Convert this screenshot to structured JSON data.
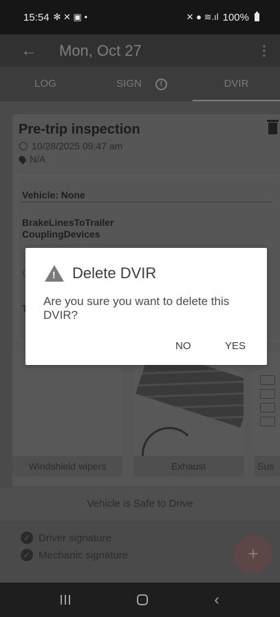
{
  "status_bar": {
    "time": "15:54",
    "left_icons": "✻ ✕ ▣ •",
    "right_icons": "✕ ● ≋.ıl",
    "battery": "100%"
  },
  "app_bar": {
    "back_icon": "arrow-left-icon",
    "title": "Mon, Oct 27",
    "menu_icon": "more-vert-icon"
  },
  "tabs": [
    {
      "label": "LOG"
    },
    {
      "label": "SIGN"
    },
    {
      "label": "DVIR",
      "selected": true
    }
  ],
  "inspection": {
    "title": "Pre-trip inspection",
    "datetime": "10/28/2025 09:47 am",
    "location": "N/A",
    "vehicle": "Vehicle: None",
    "defects": [
      "BrakeLinesToTrailer",
      "CouplingDevices"
    ],
    "peek_a": "C",
    "peek_b": "T"
  },
  "photos": [
    {
      "caption": "Windshield wipers"
    },
    {
      "caption": "Exhaust"
    },
    {
      "caption": "Sus"
    }
  ],
  "safe_status": "Vehicle is Safe to Drive",
  "signatures": [
    {
      "label": "Driver signature"
    },
    {
      "label": "Mechanic signature"
    }
  ],
  "fab_label": "+",
  "dialog": {
    "title": "Delete DVIR",
    "message": "Are you sure you want to delete this DVIR?",
    "no_label": "NO",
    "yes_label": "YES"
  },
  "colors": {
    "dialog_bg": "#ffffff",
    "fab": "#5d4746",
    "scrim": "#4a4a4a"
  }
}
